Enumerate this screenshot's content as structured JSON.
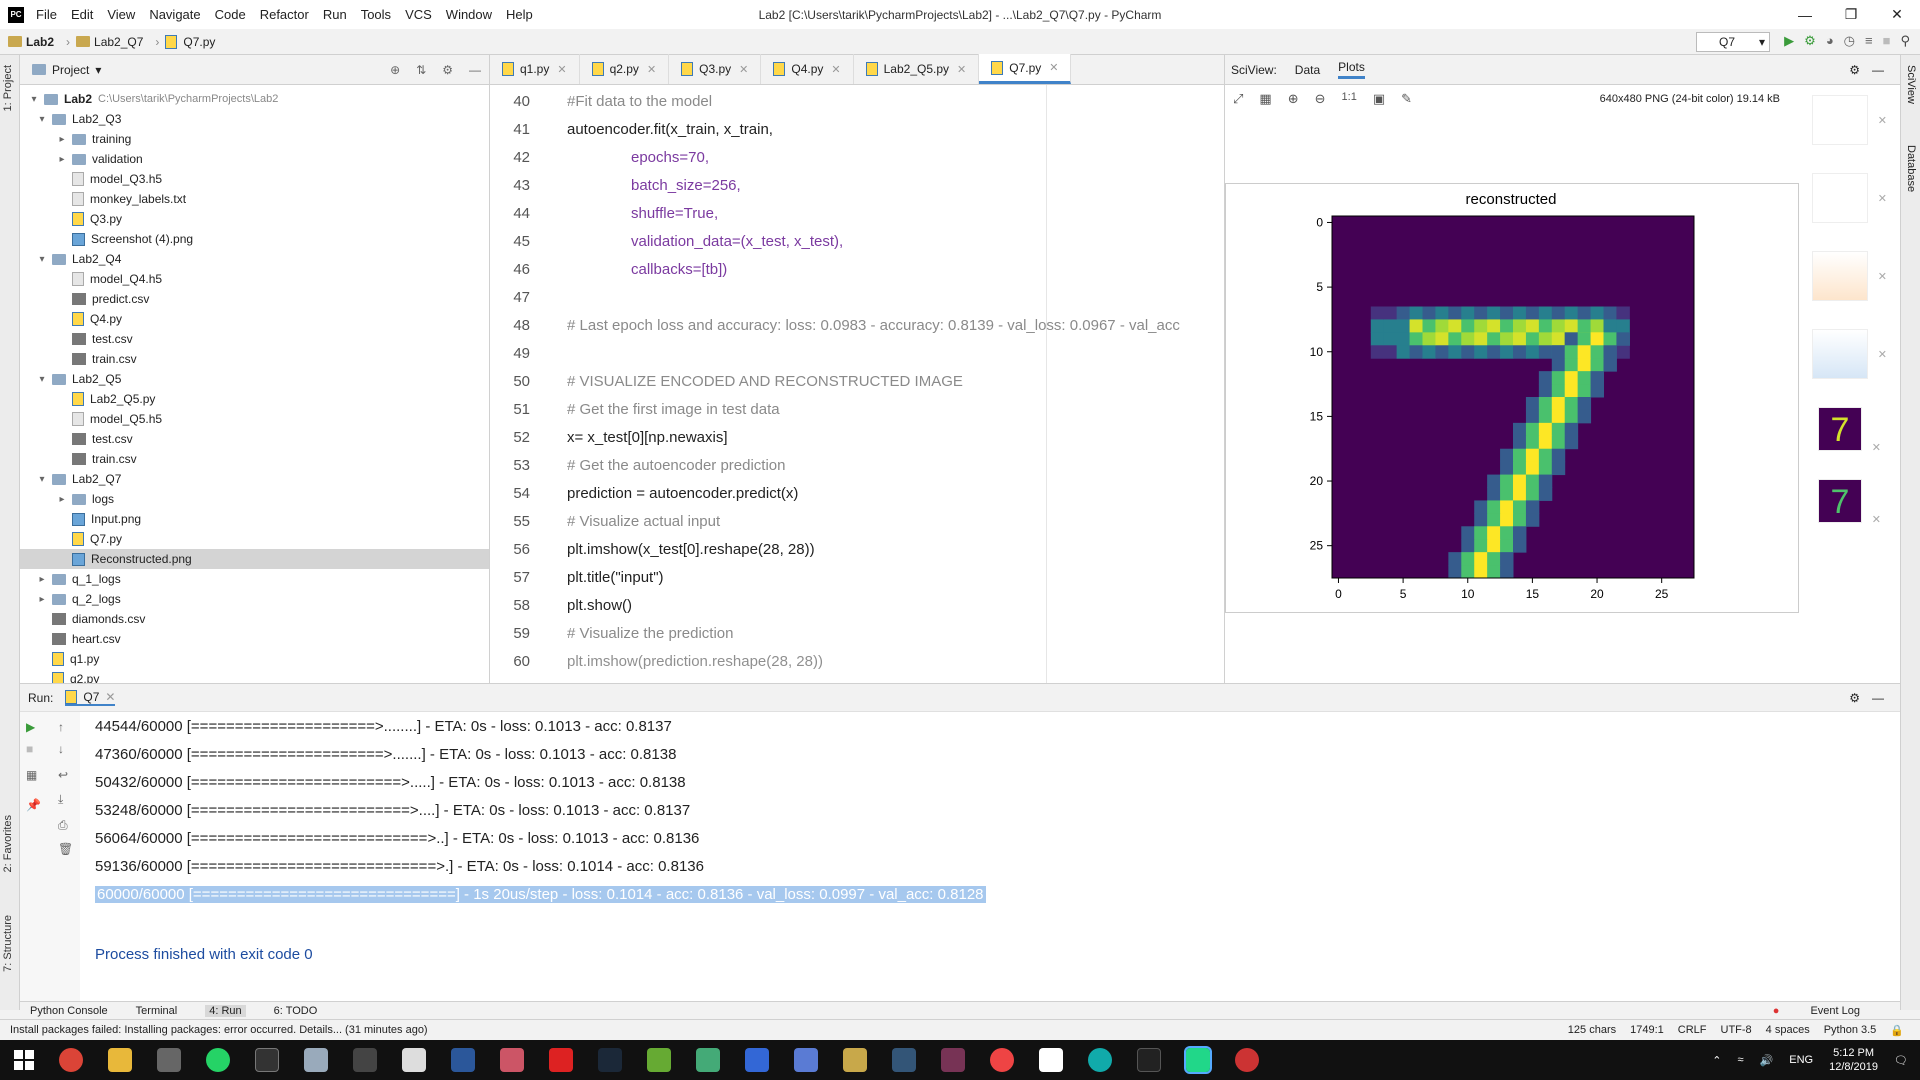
{
  "titlebar": {
    "logo": "PC",
    "menu": [
      "File",
      "Edit",
      "View",
      "Navigate",
      "Code",
      "Refactor",
      "Run",
      "Tools",
      "VCS",
      "Window",
      "Help"
    ],
    "title": "Lab2 [C:\\Users\\tarik\\PycharmProjects\\Lab2] - ...\\Lab2_Q7\\Q7.py - PyCharm"
  },
  "navbar": {
    "crumbs": [
      "Lab2",
      "Lab2_Q7",
      "Q7.py"
    ],
    "run_config": "Q7"
  },
  "project": {
    "title": "Project",
    "root_label": "Lab2",
    "root_path": "C:\\Users\\tarik\\PycharmProjects\\Lab2",
    "nodes": [
      {
        "label": "Lab2_Q3",
        "kind": "folder",
        "expanded": true
      },
      {
        "label": "training",
        "kind": "folder",
        "expanded": false
      },
      {
        "label": "validation",
        "kind": "folder",
        "expanded": false
      },
      {
        "label": "model_Q3.h5",
        "kind": "file"
      },
      {
        "label": "monkey_labels.txt",
        "kind": "file"
      },
      {
        "label": "Q3.py",
        "kind": "py"
      },
      {
        "label": "Screenshot (4).png",
        "kind": "png"
      },
      {
        "label": "Lab2_Q4",
        "kind": "folder",
        "expanded": true
      },
      {
        "label": "model_Q4.h5",
        "kind": "file"
      },
      {
        "label": "predict.csv",
        "kind": "csv"
      },
      {
        "label": "Q4.py",
        "kind": "py"
      },
      {
        "label": "test.csv",
        "kind": "csv"
      },
      {
        "label": "train.csv",
        "kind": "csv"
      },
      {
        "label": "Lab2_Q5",
        "kind": "folder",
        "expanded": true
      },
      {
        "label": "Lab2_Q5.py",
        "kind": "py"
      },
      {
        "label": "model_Q5.h5",
        "kind": "file"
      },
      {
        "label": "test.csv",
        "kind": "csv"
      },
      {
        "label": "train.csv",
        "kind": "csv"
      },
      {
        "label": "Lab2_Q7",
        "kind": "folder",
        "expanded": true
      },
      {
        "label": "logs",
        "kind": "folder",
        "expanded": false
      },
      {
        "label": "Input.png",
        "kind": "png"
      },
      {
        "label": "Q7.py",
        "kind": "py"
      },
      {
        "label": "Reconstructed.png",
        "kind": "png"
      },
      {
        "label": "q_1_logs",
        "kind": "folder",
        "expanded": false
      },
      {
        "label": "q_2_logs",
        "kind": "folder",
        "expanded": false
      },
      {
        "label": "diamonds.csv",
        "kind": "csv"
      },
      {
        "label": "heart.csv",
        "kind": "csv"
      },
      {
        "label": "q1.py",
        "kind": "py"
      },
      {
        "label": "q2.py",
        "kind": "py"
      }
    ]
  },
  "editor": {
    "tabs": [
      "q1.py",
      "q2.py",
      "Q3.py",
      "Q4.py",
      "Lab2_Q5.py",
      "Q7.py"
    ],
    "active_tab": "Q7.py",
    "lines": [
      {
        "n": "40",
        "text": "#Fit data to the model"
      },
      {
        "n": "41",
        "text": "autoencoder.fit(x_train, x_train,"
      },
      {
        "n": "42",
        "text": "epochs=70,"
      },
      {
        "n": "43",
        "text": "batch_size=256,"
      },
      {
        "n": "44",
        "text": "shuffle=True,"
      },
      {
        "n": "45",
        "text": "validation_data=(x_test, x_test),"
      },
      {
        "n": "46",
        "text": "callbacks=[tb])"
      },
      {
        "n": "47",
        "text": ""
      },
      {
        "n": "48",
        "text": "# Last epoch loss and accuracy: loss: 0.0983 - accuracy: 0.8139 - val_loss: 0.0967 - val_acc"
      },
      {
        "n": "49",
        "text": ""
      },
      {
        "n": "50",
        "text": "# VISUALIZE ENCODED AND RECONSTRUCTED IMAGE"
      },
      {
        "n": "51",
        "text": "# Get the first image in test data"
      },
      {
        "n": "52",
        "text": "x= x_test[0][np.newaxis]"
      },
      {
        "n": "53",
        "text": "# Get the autoencoder prediction"
      },
      {
        "n": "54",
        "text": "prediction = autoencoder.predict(x)"
      },
      {
        "n": "55",
        "text": "# Visualize actual input"
      },
      {
        "n": "56",
        "text": "plt.imshow(x_test[0].reshape(28, 28))"
      },
      {
        "n": "57",
        "text": "plt.title(\"input\")"
      },
      {
        "n": "58",
        "text": "plt.show()"
      },
      {
        "n": "59",
        "text": "# Visualize the prediction"
      },
      {
        "n": "60",
        "text": "plt.imshow(prediction.reshape(28, 28))"
      }
    ]
  },
  "sciview": {
    "label": "SciView:",
    "tabs": [
      "Data",
      "Plots"
    ],
    "active_tab": "Plots",
    "image_info": "640x480 PNG (24-bit color) 19.14 kB",
    "zoom_label": "1:1",
    "plot_title": "reconstructed",
    "x_ticks": [
      "0",
      "5",
      "10",
      "15",
      "20",
      "25"
    ],
    "y_ticks": [
      "0",
      "5",
      "10",
      "15",
      "20",
      "25"
    ]
  },
  "run": {
    "label": "Run:",
    "tab": "Q7",
    "output": [
      "44544/60000 [=====================>........] - ETA: 0s - loss: 0.1013 - acc: 0.8137",
      "47360/60000 [======================>.......] - ETA: 0s - loss: 0.1013 - acc: 0.8138",
      "50432/60000 [========================>.....] - ETA: 0s - loss: 0.1013 - acc: 0.8138",
      "53248/60000 [=========================>....] - ETA: 0s - loss: 0.1013 - acc: 0.8137",
      "56064/60000 [===========================>..] - ETA: 0s - loss: 0.1013 - acc: 0.8136",
      "59136/60000 [============================>.] - ETA: 0s - loss: 0.1014 - acc: 0.8136",
      "60000/60000 [==============================] - 1s 20us/step - loss: 0.1014 - acc: 0.8136 - val_loss: 0.0997 - val_acc: 0.8128"
    ],
    "finished": "Process finished with exit code 0"
  },
  "bottom_tabs": [
    "Python Console",
    "Terminal",
    "4: Run",
    "6: TODO"
  ],
  "event_log": "Event Log",
  "left_stripe": [
    "1: Project",
    "2: Favorites",
    "7: Structure"
  ],
  "right_stripe": [
    "SciView",
    "Database"
  ],
  "status": {
    "message": "Install packages failed: Installing packages: error occurred. Details... (31 minutes ago)",
    "chars": "125 chars",
    "pos": "1749:1",
    "line_sep": "CRLF",
    "encoding": "UTF-8",
    "indent": "4 spaces",
    "interpreter": "Python 3.5"
  },
  "taskbar": {
    "lang": "ENG",
    "time": "5:12 PM",
    "date": "12/8/2019"
  }
}
